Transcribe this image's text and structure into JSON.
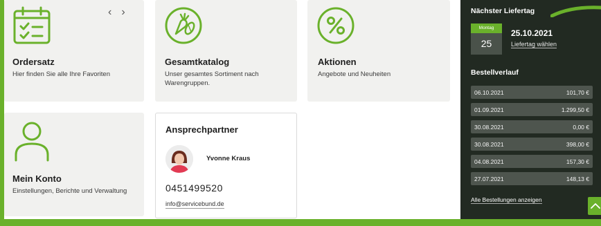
{
  "tiles": {
    "ordersatz": {
      "title": "Ordersatz",
      "subtitle": "Hier finden Sie alle Ihre Favoriten",
      "icon": "checklist-icon"
    },
    "gesamtkatalog": {
      "title": "Gesamtkatalog",
      "subtitle": "Unser gesamtes Sortiment nach Warengruppen.",
      "icon": "vegetables-icon"
    },
    "aktionen": {
      "title": "Aktionen",
      "subtitle": "Angebote und Neuheiten",
      "icon": "percent-icon"
    },
    "mein_konto": {
      "title": "Mein Konto",
      "subtitle": "Einstellungen, Berichte und Verwaltung",
      "icon": "user-icon"
    }
  },
  "carousel": {
    "prev": "‹",
    "next": "›"
  },
  "contact": {
    "title": "Ansprechpartner",
    "name": "Yvonne Kraus",
    "phone": "0451499520",
    "email": "info@servicebund.de"
  },
  "delivery": {
    "heading": "Nächster Liefertag",
    "weekday": "Montag",
    "day": "25",
    "date": "25.10.2021",
    "change_link": "Liefertag wählen"
  },
  "history": {
    "heading": "Bestellverlauf",
    "rows": [
      {
        "date": "06.10.2021",
        "amount": "101,70 €"
      },
      {
        "date": "01.09.2021",
        "amount": "1.299,50 €"
      },
      {
        "date": "30.08.2021",
        "amount": "0,00 €"
      },
      {
        "date": "30.08.2021",
        "amount": "398,00 €"
      },
      {
        "date": "04.08.2021",
        "amount": "157,30 €"
      },
      {
        "date": "27.07.2021",
        "amount": "148,13 €"
      }
    ],
    "all_link": "Alle Bestellungen anzeigen"
  },
  "colors": {
    "accent": "#6ab12b",
    "panel": "#222a22",
    "tile": "#f1f1ef"
  }
}
